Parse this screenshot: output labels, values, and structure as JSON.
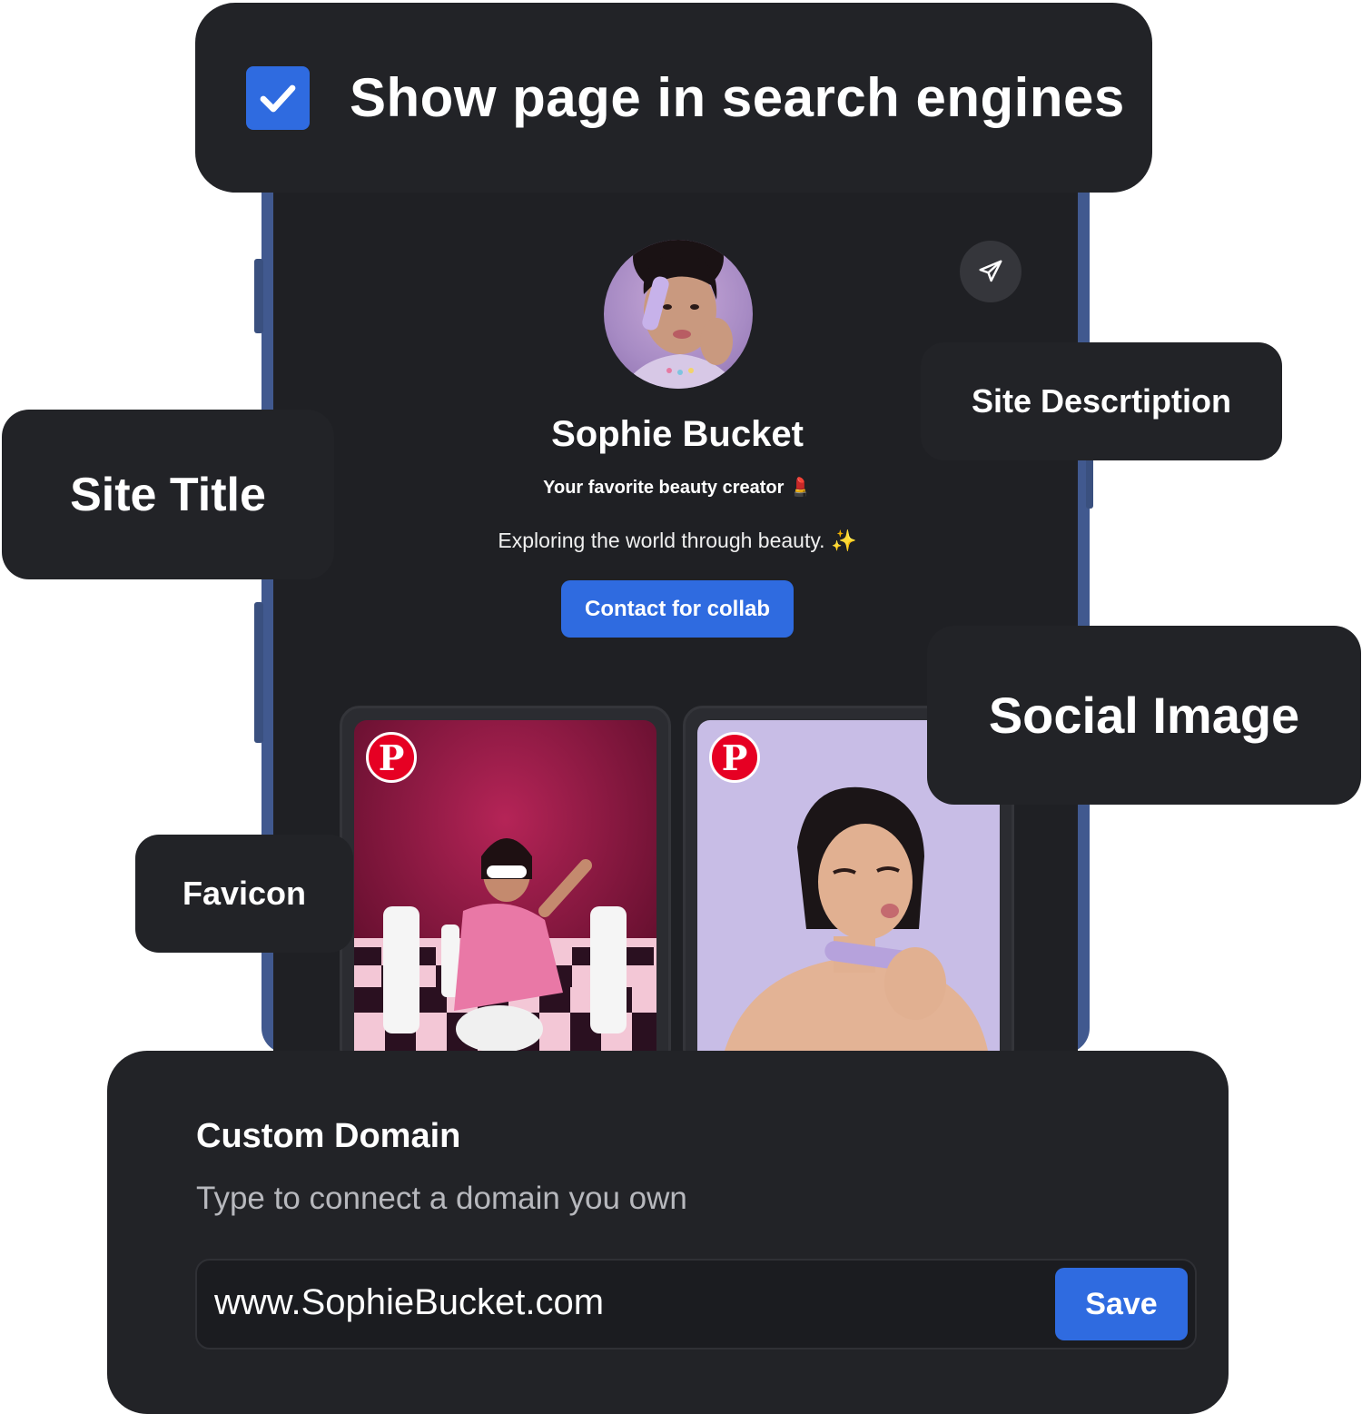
{
  "banner": {
    "checkbox_checked": true,
    "label": "Show page in search engines"
  },
  "labels": {
    "site_title": "Site Title",
    "site_description": "Site Descrtiption",
    "social_image": "Social Image",
    "favicon": "Favicon"
  },
  "profile": {
    "name": "Sophie Bucket",
    "tagline": "Your favorite beauty creator 💄",
    "bio": "Exploring the world through beauty. ✨",
    "cta_label": "Contact for collab"
  },
  "pins": [
    {
      "icon": "pinterest-icon",
      "logo_text": "P"
    },
    {
      "icon": "pinterest-icon",
      "logo_text": "P"
    }
  ],
  "custom_domain": {
    "title": "Custom Domain",
    "subtitle": "Type to connect a domain you own",
    "value": "www.SophieBucket.com",
    "save_label": "Save"
  },
  "colors": {
    "accent": "#2f6be0",
    "card_bg": "#222327",
    "screen_bg": "#1f2024",
    "phone_frame": "#41598f",
    "pinterest_red": "#e60023"
  }
}
